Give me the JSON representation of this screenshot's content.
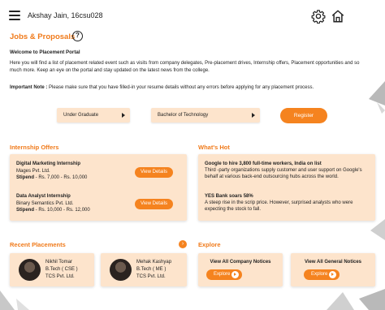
{
  "header": {
    "user": "Akshay Jain, 16csu028",
    "icons": [
      "menu-icon",
      "settings-gear-icon",
      "home-icon"
    ]
  },
  "page": {
    "title": "Jobs & Proposals",
    "welcome": "Welcome to Placement Portal",
    "intro": "Here you will find a list of placement related event such as visits from company delegates, Pre-placement drives, Internship offers, Placement opportunities and so much more. Keep an eye on the portal and stay updated on the latest news from the college.",
    "note_label": "Important Note :",
    "note_text": " Please make sure that you have filled-in your resume details without any errors before applying for any placement process."
  },
  "form": {
    "level": "Under Graduate",
    "course": "Bachelor of Technology",
    "register_label": "Register"
  },
  "internships": {
    "title": "Internship Offers",
    "view_label": "View Details",
    "items": [
      {
        "title": "Digital Marketing Internship",
        "company": "Mages Pvt. Ltd.",
        "stipend_label": "Stipend",
        "stipend": " - Rs. 7,000 - Rs. 10,000"
      },
      {
        "title": "Data Analyst Internship",
        "company": "Binary Semantics Pvt. Ltd.",
        "stipend_label": "Stipend",
        "stipend": " - Rs. 10,000 - Rs. 12,000"
      }
    ]
  },
  "whats_hot": {
    "title": "What's Hot",
    "items": [
      {
        "title": "Google to hire 3,800 full-time workers, India on list",
        "text": "Third -party organizations supply customer and user support on Google's behalf at various back-end outsourcing hubs across the world."
      },
      {
        "title": "YES Bank soars 58%",
        "text": "A steep rise in the scrip price. However, surprised analysts who were expecting the stock to fall."
      }
    ]
  },
  "placements": {
    "title": "Recent Placements",
    "items": [
      {
        "name": "Nikhil Tomar",
        "degree": "B.Tech ( CSE )",
        "company": "TCS Pvt. Ltd."
      },
      {
        "name": "Mehak Kashyap",
        "degree": "B.Tech ( ME )",
        "company": "TCS Pvt. Ltd."
      }
    ]
  },
  "explore": {
    "title": "Explore",
    "button_label": "Explore",
    "cards": [
      {
        "title": "View All Company Notices"
      },
      {
        "title": "View All General Notices"
      }
    ]
  },
  "colors": {
    "accent": "#f5831f",
    "panel": "#fde4cc",
    "title": "#f07a1a"
  }
}
